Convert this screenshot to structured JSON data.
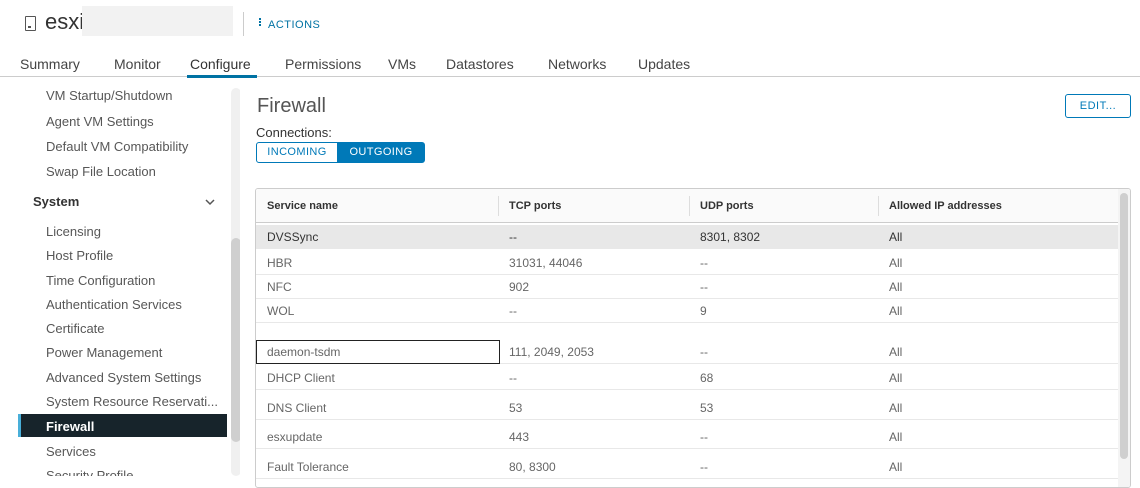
{
  "header": {
    "host_name": "esxi",
    "actions_label": "ACTIONS"
  },
  "tabs": [
    {
      "label": "Summary"
    },
    {
      "label": "Monitor"
    },
    {
      "label": "Configure"
    },
    {
      "label": "Permissions"
    },
    {
      "label": "VMs"
    },
    {
      "label": "Datastores"
    },
    {
      "label": "Networks"
    },
    {
      "label": "Updates"
    }
  ],
  "sidebar": {
    "top_items": [
      "VM Startup/Shutdown",
      "Agent VM Settings",
      "Default VM Compatibility",
      "Swap File Location"
    ],
    "section": "System",
    "items": [
      "Licensing",
      "Host Profile",
      "Time Configuration",
      "Authentication Services",
      "Certificate",
      "Power Management",
      "Advanced System Settings",
      "System Resource Reservati...",
      "Firewall",
      "Services",
      "Security Profile"
    ],
    "active": "Firewall"
  },
  "main": {
    "title": "Firewall",
    "edit_label": "EDIT...",
    "connections_label": "Connections:",
    "incoming_label": "INCOMING",
    "outgoing_label": "OUTGOING",
    "selected_toggle": "OUTGOING"
  },
  "table": {
    "columns": [
      "Service name",
      "TCP ports",
      "UDP ports",
      "Allowed IP addresses"
    ],
    "rows": [
      [
        "DVSSync",
        "--",
        "8301, 8302",
        "All"
      ],
      [
        "HBR",
        "31031, 44046",
        "--",
        "All"
      ],
      [
        "NFC",
        "902",
        "--",
        "All"
      ],
      [
        "WOL",
        "--",
        "9",
        "All"
      ],
      [
        "daemon-tsdm",
        "111, 2049, 2053",
        "--",
        "All"
      ],
      [
        "DHCP Client",
        "--",
        "68",
        "All"
      ],
      [
        "DNS Client",
        "53",
        "53",
        "All"
      ],
      [
        "esxupdate",
        "443",
        "--",
        "All"
      ],
      [
        "Fault Tolerance",
        "80, 8300",
        "--",
        "All"
      ]
    ],
    "selected_row": "DVSSync",
    "focused_cell": "daemon-tsdm"
  },
  "colors": {
    "accent": "#0079b8",
    "sidebar_active_bg": "#17242b",
    "sidebar_active_bar": "#49afd9"
  }
}
